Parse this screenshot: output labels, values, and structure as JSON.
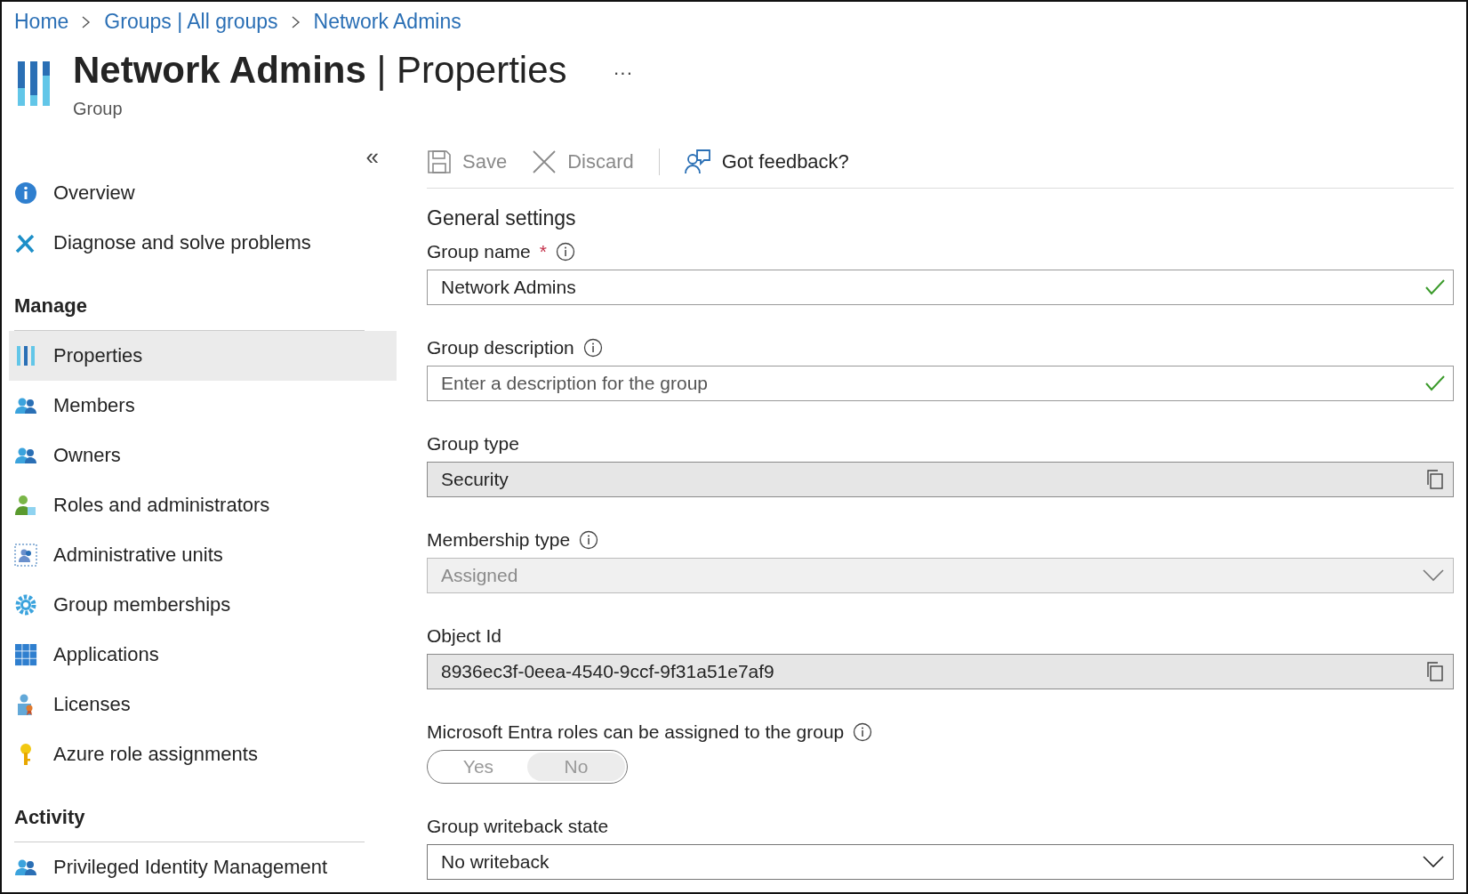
{
  "breadcrumb": [
    "Home",
    "Groups | All groups",
    "Network Admins"
  ],
  "header": {
    "title_bold": "Network Admins",
    "title_sep": "|",
    "title_rest": "Properties",
    "subtitle": "Group",
    "more": "···"
  },
  "sidebar": {
    "collapse": "«",
    "sections": [
      {
        "items": [
          {
            "label": "Overview",
            "kind": "info",
            "selected": false
          },
          {
            "label": "Diagnose and solve problems",
            "kind": "tools",
            "selected": false
          }
        ]
      },
      {
        "heading": "Manage",
        "items": [
          {
            "label": "Properties",
            "kind": "bars",
            "selected": true
          },
          {
            "label": "Members",
            "kind": "people",
            "selected": false
          },
          {
            "label": "Owners",
            "kind": "people",
            "selected": false
          },
          {
            "label": "Roles and administrators",
            "kind": "role",
            "selected": false
          },
          {
            "label": "Administrative units",
            "kind": "units",
            "selected": false
          },
          {
            "label": "Group memberships",
            "kind": "gear",
            "selected": false
          },
          {
            "label": "Applications",
            "kind": "grid",
            "selected": false
          },
          {
            "label": "Licenses",
            "kind": "license",
            "selected": false
          },
          {
            "label": "Azure role assignments",
            "kind": "key",
            "selected": false
          }
        ]
      },
      {
        "heading": "Activity",
        "items": [
          {
            "label": "Privileged Identity Management",
            "kind": "people",
            "selected": false
          }
        ]
      }
    ]
  },
  "toolbar": [
    {
      "label": "Save",
      "kind": "save",
      "disabled": true
    },
    {
      "label": "Discard",
      "kind": "discard",
      "disabled": true
    },
    {
      "label": "Got feedback?",
      "kind": "feedback",
      "disabled": false
    }
  ],
  "section_title": "General settings",
  "fields": [
    {
      "kind": "text",
      "label": "Group name",
      "required_mark": "*",
      "info": true,
      "value": "Network Admins",
      "valid": true
    },
    {
      "kind": "text",
      "label": "Group description",
      "info": true,
      "placeholder": "Enter a description for the group",
      "valid": true
    },
    {
      "kind": "readonly",
      "label": "Group type",
      "info": false,
      "value": "Security"
    },
    {
      "kind": "dropdown",
      "label": "Membership type",
      "info": true,
      "value": "Assigned",
      "disabled": true
    },
    {
      "kind": "readonly",
      "label": "Object Id",
      "info": false,
      "value": "8936ec3f-0eea-4540-9ccf-9f31a51e7af9"
    },
    {
      "kind": "toggle",
      "label": "Microsoft Entra roles can be assigned to the group",
      "info": true,
      "disabled": true,
      "options": [
        {
          "label": "Yes",
          "selected": false
        },
        {
          "label": "No",
          "selected": true
        }
      ]
    },
    {
      "kind": "dropdown",
      "label": "Group writeback state",
      "info": false,
      "value": "No writeback",
      "disabled": false
    }
  ]
}
